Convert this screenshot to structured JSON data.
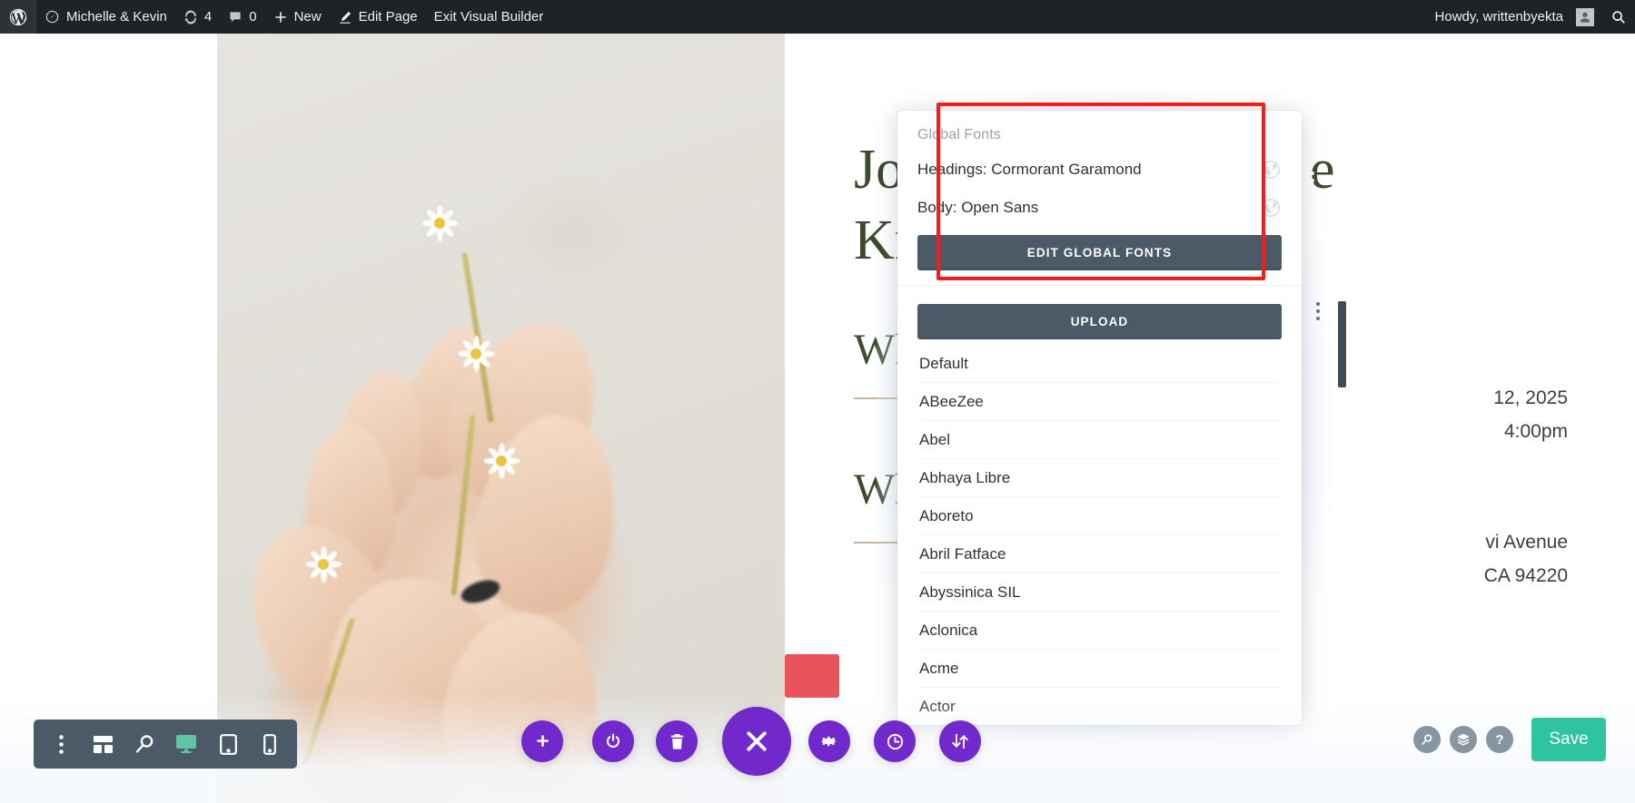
{
  "adminbar": {
    "wp_logo": "wordpress-logo-icon",
    "site_name": "Michelle & Kevin",
    "site_icon": "dashboard-icon",
    "updates_icon": "updates-icon",
    "updates_count": "4",
    "comments_icon": "comments-icon",
    "comments_count": "0",
    "new_icon": "plus-icon",
    "new_label": "New",
    "edit_icon": "pencil-icon",
    "edit_label": "Edit Page",
    "exit_label": "Exit Visual Builder",
    "howdy": "Howdy, writtenbyekta",
    "avatar": "user-avatar-icon",
    "search_icon": "search-icon"
  },
  "page": {
    "heading_line1": "Jo",
    "heading_line2": "Kn",
    "heading_tail": "e",
    "subheading1": "Wh",
    "subheading2": "Wh",
    "meta_date": "12, 2025",
    "meta_time": "4:00pm",
    "meta_address1": "vi Avenue",
    "meta_address2": "CA 94220",
    "photo_alt": "hands-holding-daisies-photo"
  },
  "font_panel": {
    "global_fonts": {
      "title": "Global Fonts",
      "headings_label": "Headings: Cormorant Garamond",
      "headings_globe_icon": "globe-icon",
      "body_label": "Body: Open Sans",
      "body_globe_icon": "globe-icon",
      "edit_button": "EDIT GLOBAL FONTS"
    },
    "upload_button": "UPLOAD",
    "fonts": [
      "Default",
      "ABeeZee",
      "Abel",
      "Abhaya Libre",
      "Aboreto",
      "Abril Fatface",
      "Abyssinica SIL",
      "Aclonica",
      "Acme",
      "Actor"
    ]
  },
  "bottom_toolbar": {
    "left_items": [
      {
        "name": "more-options-icon",
        "label": ""
      },
      {
        "name": "wireframe-icon",
        "label": ""
      },
      {
        "name": "zoom-out-icon",
        "label": ""
      },
      {
        "name": "desktop-view-icon",
        "label": ""
      },
      {
        "name": "tablet-view-icon",
        "label": ""
      },
      {
        "name": "phone-view-icon",
        "label": ""
      }
    ],
    "center_items": [
      {
        "name": "add-module-icon"
      },
      {
        "name": "power-toggle-icon"
      },
      {
        "name": "delete-icon"
      },
      {
        "name": "close-menu-icon"
      },
      {
        "name": "settings-gear-icon"
      },
      {
        "name": "history-clock-icon"
      },
      {
        "name": "portability-icon"
      }
    ],
    "right_items": [
      {
        "name": "search-icon"
      },
      {
        "name": "layers-icon"
      },
      {
        "name": "help-icon"
      }
    ],
    "save_label": "Save"
  },
  "colors": {
    "admin_bar": "#1d2327",
    "divi_purple": "#7229cc",
    "save_teal": "#2ec4a0",
    "slate": "#4c5a67",
    "highlight_red": "#f41c1c",
    "heading_green": "#3c4a2d",
    "cta_red": "#e8545a",
    "cta_teal": "#25b898"
  }
}
